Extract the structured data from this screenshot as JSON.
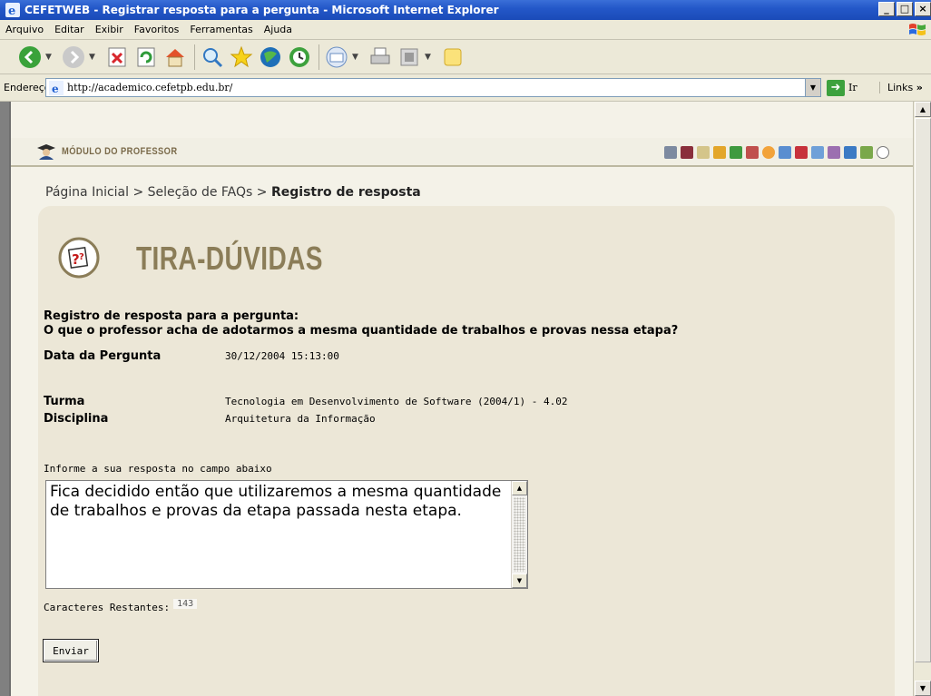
{
  "window": {
    "title": "CEFETWEB - Registrar resposta para a pergunta - Microsoft Internet Explorer",
    "minimize": "_",
    "maximize": "□",
    "close": "×"
  },
  "menubar": {
    "items": [
      "Arquivo",
      "Editar",
      "Exibir",
      "Favoritos",
      "Ferramentas",
      "Ajuda"
    ]
  },
  "toolbar": {
    "buttons": [
      "back-icon",
      "forward-icon",
      "stop-icon",
      "refresh-icon",
      "home-icon",
      "search-icon",
      "favorites-icon",
      "media-icon",
      "history-icon",
      "mail-icon",
      "print-icon",
      "edit-icon",
      "messenger-icon"
    ]
  },
  "addressbar": {
    "label": "Endereço",
    "url": "http://academico.cefetpb.edu.br/",
    "go_label": "Ir",
    "links_label": "Links",
    "links_chevron": "»"
  },
  "module": {
    "title": "MÓDULO DO PROFESSOR"
  },
  "breadcrumb": {
    "home": "Página Inicial",
    "separator": ">",
    "faqs": "Seleção de FAQs",
    "current": "Registro de resposta"
  },
  "section": {
    "title": "TIRA-DÚVIDAS"
  },
  "question": {
    "heading_line1": "Registro de resposta para a pergunta:",
    "heading_line2": "O que o professor acha de adotarmos a mesma quantidade de trabalhos e provas nessa etapa?",
    "date_label": "Data da Pergunta",
    "date_value": "30/12/2004 15:13:00",
    "class_label": "Turma",
    "class_value": "Tecnologia em Desenvolvimento de Software (2004/1) - 4.02",
    "subject_label": "Disciplina",
    "subject_value": "Arquitetura da Informação"
  },
  "answer": {
    "instruction": "Informe a sua resposta no campo abaixo",
    "value": "Fica decidido então que utilizaremos a mesma quantidade de trabalhos e provas da etapa passada nesta etapa.",
    "remaining_label": "Caracteres Restantes:",
    "remaining_count": "143",
    "submit_label": "Enviar"
  }
}
